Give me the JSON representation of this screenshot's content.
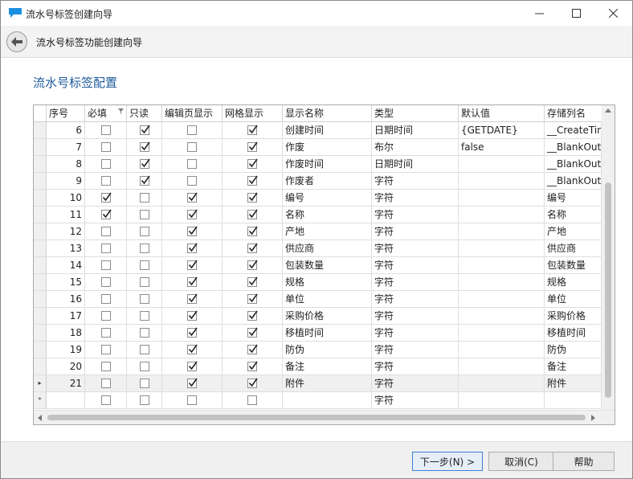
{
  "window": {
    "title": "流水号标签创建向导",
    "accent_color": "#1a8fe0"
  },
  "header": {
    "title": "流水号标签功能创建向导"
  },
  "section": {
    "title": "流水号标签配置"
  },
  "grid": {
    "columns": [
      "序号",
      "必填",
      "只读",
      "编辑页显示",
      "网格显示",
      "显示名称",
      "类型",
      "默认值",
      "存储列名"
    ],
    "rows": [
      {
        "no": "6",
        "required": false,
        "readonly": true,
        "edit_visible": false,
        "grid_visible": true,
        "name": "创建时间",
        "type": "日期时间",
        "default": "{GETDATE}",
        "column": "__CreateTim"
      },
      {
        "no": "7",
        "required": false,
        "readonly": true,
        "edit_visible": false,
        "grid_visible": true,
        "name": "作废",
        "type": "布尔",
        "default": "false",
        "column": "__BlankOut_"
      },
      {
        "no": "8",
        "required": false,
        "readonly": true,
        "edit_visible": false,
        "grid_visible": true,
        "name": "作废时间",
        "type": "日期时间",
        "default": "",
        "column": "__BlankOutT"
      },
      {
        "no": "9",
        "required": false,
        "readonly": true,
        "edit_visible": false,
        "grid_visible": true,
        "name": "作废者",
        "type": "字符",
        "default": "",
        "column": "__BlankOutU"
      },
      {
        "no": "10",
        "required": true,
        "readonly": false,
        "edit_visible": true,
        "grid_visible": true,
        "name": "编号",
        "type": "字符",
        "default": "",
        "column": "编号"
      },
      {
        "no": "11",
        "required": true,
        "readonly": false,
        "edit_visible": true,
        "grid_visible": true,
        "name": "名称",
        "type": "字符",
        "default": "",
        "column": "名称"
      },
      {
        "no": "12",
        "required": false,
        "readonly": false,
        "edit_visible": true,
        "grid_visible": true,
        "name": "产地",
        "type": "字符",
        "default": "",
        "column": "产地"
      },
      {
        "no": "13",
        "required": false,
        "readonly": false,
        "edit_visible": true,
        "grid_visible": true,
        "name": "供应商",
        "type": "字符",
        "default": "",
        "column": "供应商"
      },
      {
        "no": "14",
        "required": false,
        "readonly": false,
        "edit_visible": true,
        "grid_visible": true,
        "name": "包装数量",
        "type": "字符",
        "default": "",
        "column": "包装数量"
      },
      {
        "no": "15",
        "required": false,
        "readonly": false,
        "edit_visible": true,
        "grid_visible": true,
        "name": "规格",
        "type": "字符",
        "default": "",
        "column": "规格"
      },
      {
        "no": "16",
        "required": false,
        "readonly": false,
        "edit_visible": true,
        "grid_visible": true,
        "name": "单位",
        "type": "字符",
        "default": "",
        "column": "单位"
      },
      {
        "no": "17",
        "required": false,
        "readonly": false,
        "edit_visible": true,
        "grid_visible": true,
        "name": "采购价格",
        "type": "字符",
        "default": "",
        "column": "采购价格"
      },
      {
        "no": "18",
        "required": false,
        "readonly": false,
        "edit_visible": true,
        "grid_visible": true,
        "name": "移植时间",
        "type": "字符",
        "default": "",
        "column": "移植时间"
      },
      {
        "no": "19",
        "required": false,
        "readonly": false,
        "edit_visible": true,
        "grid_visible": true,
        "name": "防伪",
        "type": "字符",
        "default": "",
        "column": "防伪"
      },
      {
        "no": "20",
        "required": false,
        "readonly": false,
        "edit_visible": true,
        "grid_visible": true,
        "name": "备注",
        "type": "字符",
        "default": "",
        "column": "备注"
      },
      {
        "no": "21",
        "required": false,
        "readonly": false,
        "edit_visible": true,
        "grid_visible": true,
        "name": "附件",
        "type": "字符",
        "default": "",
        "column": "附件",
        "current": true
      },
      {
        "no": "",
        "required": false,
        "readonly": false,
        "edit_visible": false,
        "grid_visible": false,
        "name": "",
        "type": "字符",
        "default": "",
        "column": "",
        "new_row": true
      }
    ],
    "current_row_marker": "▸",
    "new_row_marker": "*"
  },
  "footer": {
    "next_label": "下一步(N) >",
    "cancel_label": "取消(C)",
    "help_label": "帮助"
  }
}
